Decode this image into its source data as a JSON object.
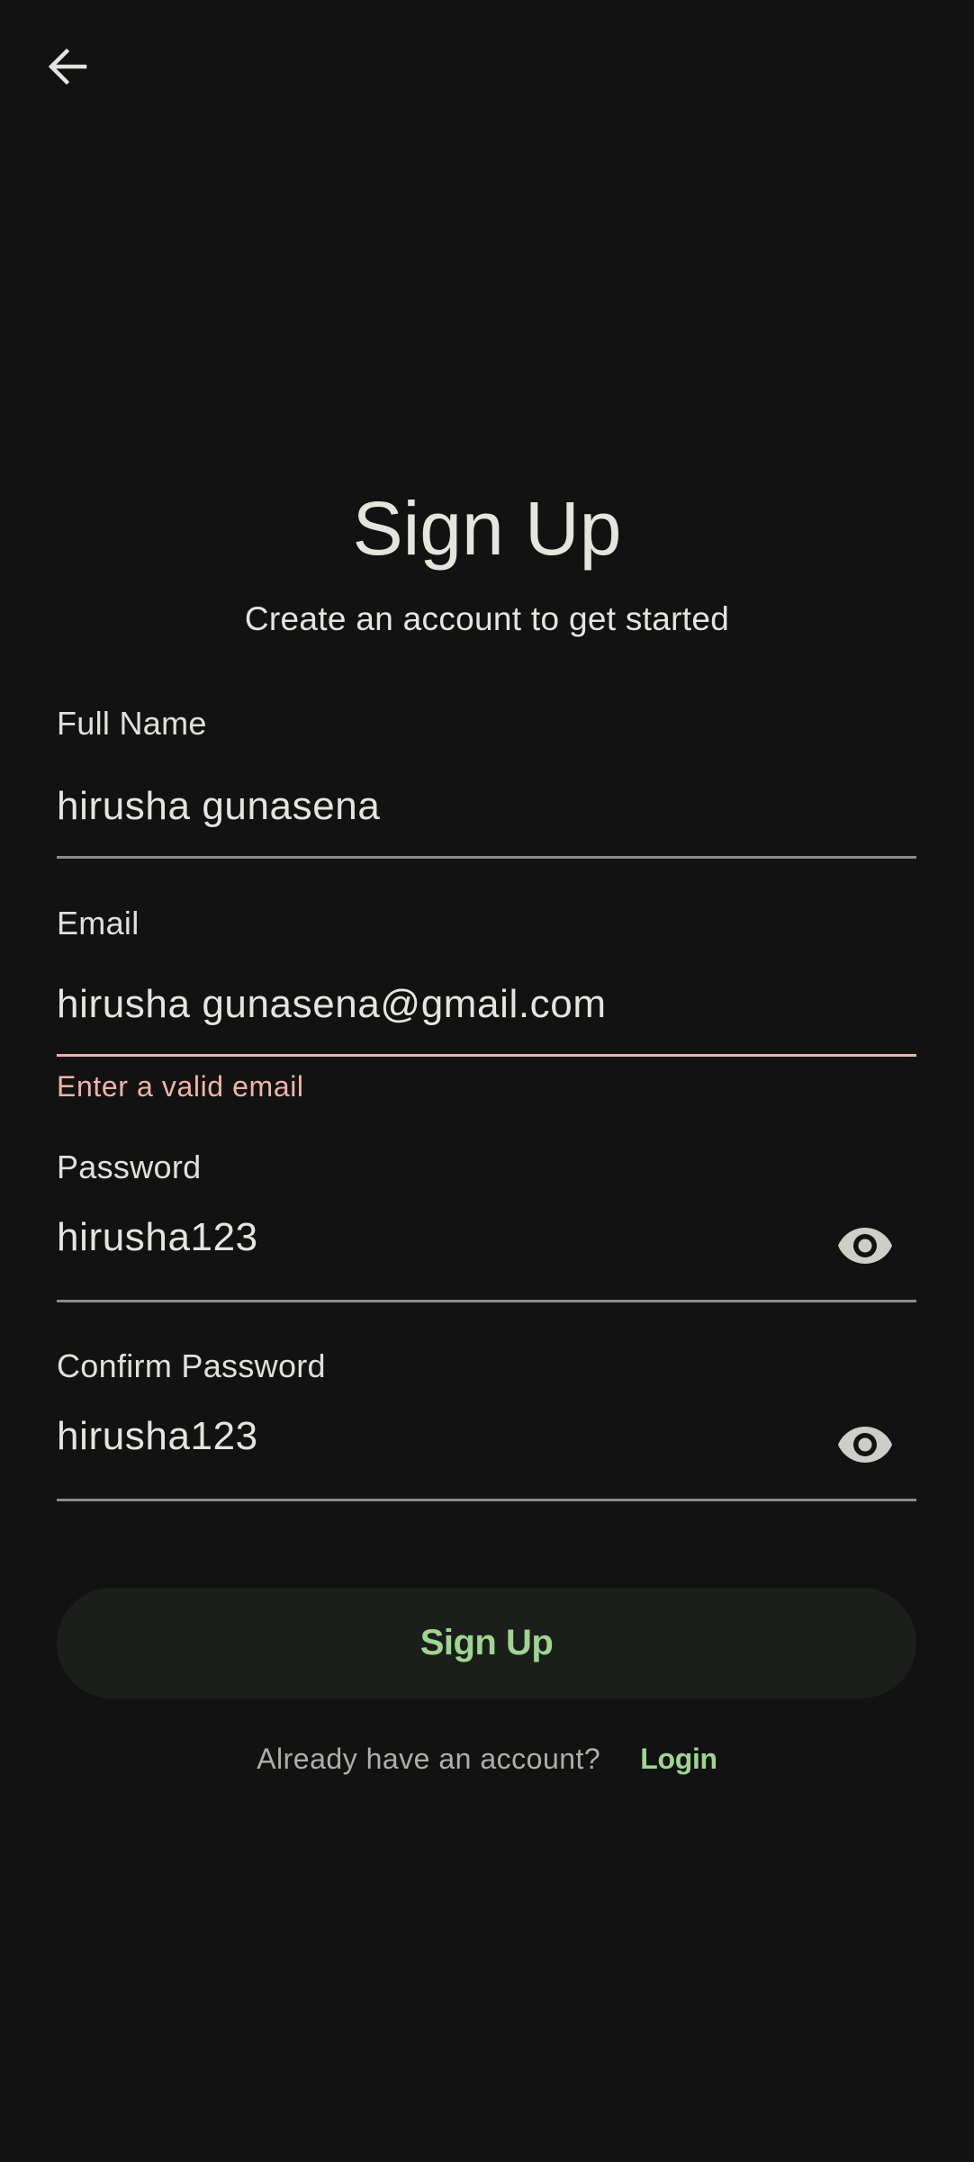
{
  "header": {
    "back_icon": "arrow-left-icon"
  },
  "title": "Sign Up",
  "subtitle": "Create an account to get started",
  "form": {
    "full_name": {
      "label": "Full Name",
      "value": "hirusha gunasena"
    },
    "email": {
      "label": "Email",
      "value": "hirusha gunasena@gmail.com",
      "error": "Enter a valid email"
    },
    "password": {
      "label": "Password",
      "value": "hirusha123",
      "toggle_icon": "eye-icon"
    },
    "confirm_password": {
      "label": "Confirm Password",
      "value": "hirusha123",
      "toggle_icon": "eye-icon"
    }
  },
  "signup_button": {
    "label": "Sign Up"
  },
  "footer": {
    "question": "Already have an account?",
    "login_label": "Login"
  },
  "colors": {
    "background": "#121212",
    "text": "#e6e4de",
    "accent_green": "#9ed592",
    "error": "#f1b4a8",
    "button_bg": "#1b1e1a",
    "underline": "#8e8c88"
  }
}
